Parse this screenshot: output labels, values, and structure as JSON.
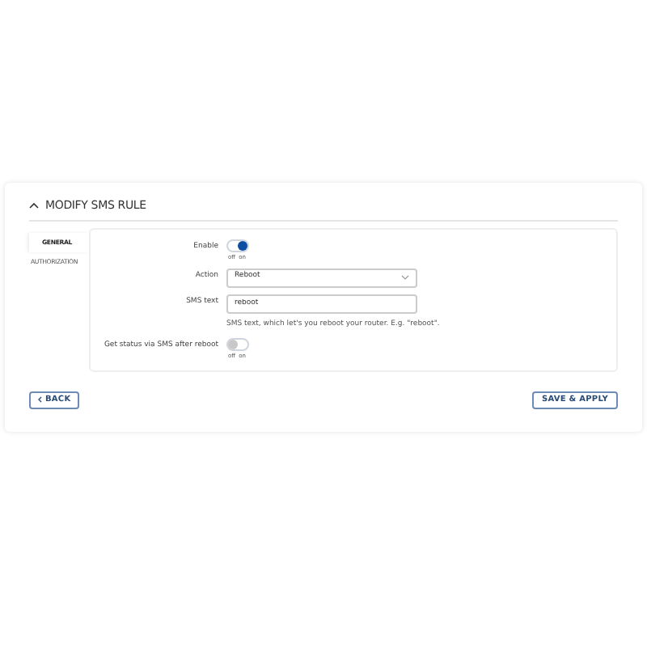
{
  "section": {
    "title": "MODIFY SMS RULE",
    "expanded": true
  },
  "tabs": [
    {
      "label": "GENERAL",
      "selected": true
    },
    {
      "label": "AUTHORIZATION",
      "selected": false
    }
  ],
  "fields": [
    {
      "kind": "toggle",
      "label": "Enable",
      "on": true,
      "off_text": "off",
      "on_text": "on"
    },
    {
      "kind": "select",
      "label": "Action",
      "value": "Reboot"
    },
    {
      "kind": "text",
      "label": "SMS text",
      "value": "reboot",
      "hint": "SMS text, which let's you reboot your router. E.g. \"reboot\"."
    },
    {
      "kind": "toggle",
      "label": "Get status via SMS after reboot",
      "on": false,
      "off_text": "off",
      "on_text": "on"
    }
  ],
  "buttons": {
    "back": "BACK",
    "save": "SAVE & APPLY"
  }
}
